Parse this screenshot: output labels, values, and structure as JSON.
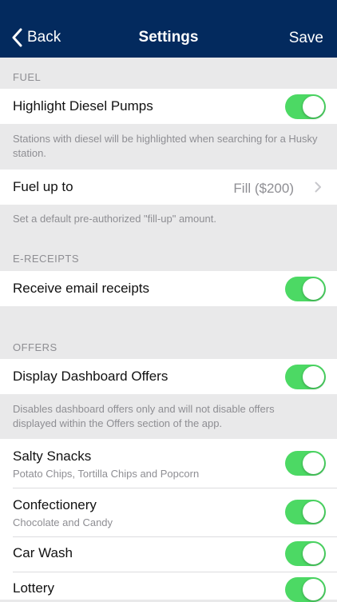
{
  "nav": {
    "back_label": "Back",
    "title": "Settings",
    "save_label": "Save"
  },
  "colors": {
    "nav_bg": "#032a5e",
    "toggle_on": "#4cd964",
    "muted": "#8e8e93"
  },
  "icons": {
    "back": "chevron-left-icon",
    "disclosure": "chevron-right-icon"
  },
  "fuel": {
    "header": "FUEL",
    "diesel": {
      "label": "Highlight Diesel Pumps",
      "enabled": true
    },
    "diesel_note": "Stations with diesel will be highlighted when searching for a Husky station.",
    "fuel_up": {
      "label": "Fuel up to",
      "value": "Fill ($200)"
    },
    "fuel_up_note": "Set a default pre-authorized \"fill-up\" amount."
  },
  "ereceipts": {
    "header": "E-RECEIPTS",
    "email": {
      "label": "Receive email receipts",
      "enabled": true
    }
  },
  "offers": {
    "header": "OFFERS",
    "dashboard": {
      "label": "Display Dashboard Offers",
      "enabled": true
    },
    "dashboard_note": "Disables dashboard offers only and will not disable offers displayed within the Offers section of the app.",
    "items": [
      {
        "label": "Salty Snacks",
        "sub": "Potato Chips, Tortilla Chips and Popcorn",
        "enabled": true
      },
      {
        "label": "Confectionery",
        "sub": "Chocolate and Candy",
        "enabled": true
      },
      {
        "label": "Car Wash",
        "sub": "",
        "enabled": true
      },
      {
        "label": "Lottery",
        "sub": "",
        "enabled": true
      }
    ]
  }
}
